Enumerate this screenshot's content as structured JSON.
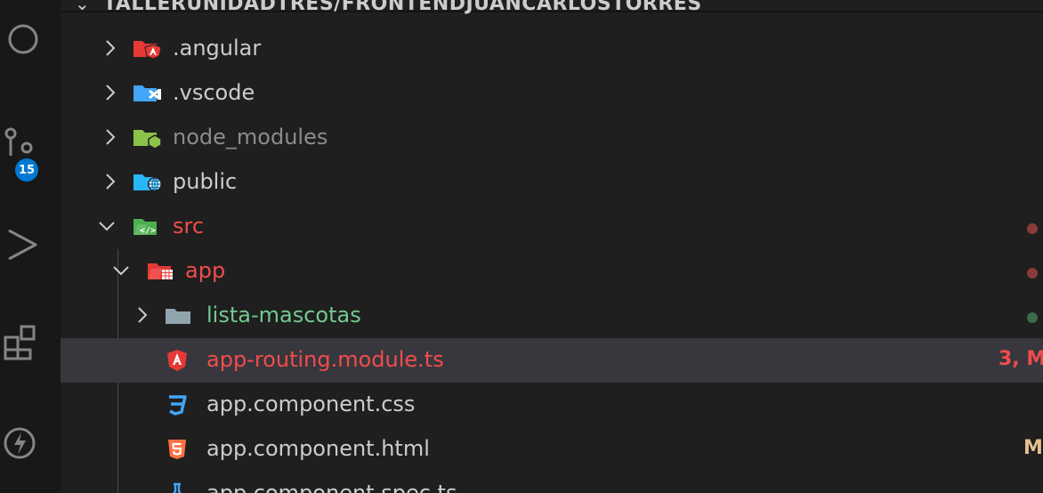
{
  "explorer": {
    "root_title": "TALLERUNIDADTRES/FRONTENDJUANCARLOSTORRES"
  },
  "activity_bar": {
    "items": [
      {
        "name": "search-icon"
      },
      {
        "name": "source-control-icon",
        "badge": "15"
      },
      {
        "name": "run-debug-icon"
      },
      {
        "name": "extensions-icon"
      },
      {
        "name": "lightning-icon"
      }
    ]
  },
  "tree": {
    "items": [
      {
        "label": ".angular",
        "expanded": false,
        "color": "#cccccc",
        "icon": "angular-folder-icon"
      },
      {
        "label": ".vscode",
        "expanded": false,
        "color": "#cccccc",
        "icon": "vscode-folder-icon"
      },
      {
        "label": "node_modules",
        "expanded": false,
        "color": "#8c8c8c",
        "icon": "node-folder-icon"
      },
      {
        "label": "public",
        "expanded": false,
        "color": "#cccccc",
        "icon": "public-folder-icon"
      },
      {
        "label": "src",
        "expanded": true,
        "color": "#f14c4c",
        "icon": "src-folder-icon"
      },
      {
        "label": "app",
        "expanded": true,
        "color": "#f14c4c",
        "icon": "app-folder-icon"
      },
      {
        "label": "lista-mascotas",
        "expanded": false,
        "color": "#73c991",
        "icon": "folder-icon"
      },
      {
        "label": "app-routing.module.ts",
        "color": "#f14c4c",
        "icon": "angular-file-icon",
        "status": "3, M",
        "selected": true
      },
      {
        "label": "app.component.css",
        "color": "#cccccc",
        "icon": "css-file-icon"
      },
      {
        "label": "app.component.html",
        "color": "#cccccc",
        "icon": "html-file-icon",
        "status": "M"
      },
      {
        "label": "app.component.spec.ts",
        "color": "#cccccc",
        "icon": "test-file-icon"
      }
    ]
  },
  "colors": {
    "error": "#f14c4c",
    "untracked": "#73c991",
    "dot_error": "#8b3a3a",
    "dot_ok": "#3d6b4a",
    "modified_text": "#e2c08d"
  }
}
